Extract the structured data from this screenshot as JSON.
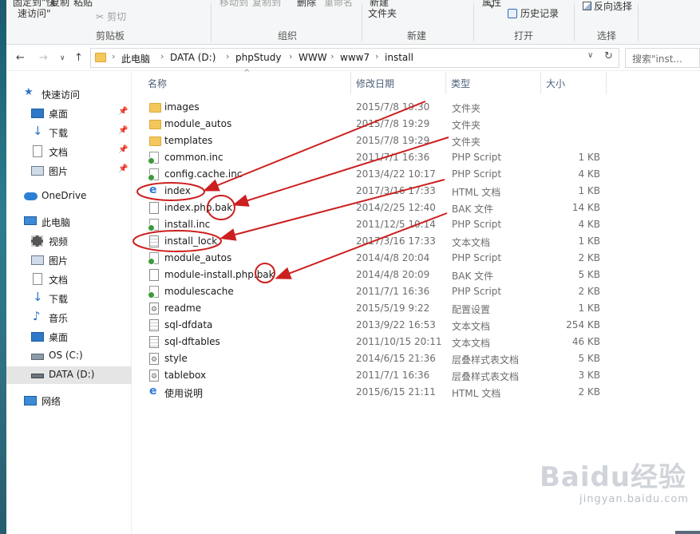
{
  "ribbon": {
    "clip_top": [
      {
        "label": "固定到\"快",
        "name": "pin-quick-access-button"
      },
      {
        "label": "复制",
        "name": "copy-button"
      },
      {
        "label": "粘贴",
        "name": "paste-button"
      },
      {
        "label": "移动到",
        "name": "move-to-button"
      },
      {
        "label": "复制到",
        "name": "copy-to-button"
      },
      {
        "label": "删除",
        "name": "delete-button"
      },
      {
        "label": "重命名",
        "name": "rename-button"
      },
      {
        "label": "新建",
        "name": "new-button"
      },
      {
        "label": "属性",
        "name": "properties-button"
      },
      {
        "label": "反向选择",
        "name": "invert-selection-button"
      }
    ],
    "pin_line2": "速访问\"",
    "cut": "剪切",
    "new_folder": "文件夹",
    "history": "历史记录",
    "groups": {
      "clipboard": "剪贴板",
      "organize": "组织",
      "new": "新建",
      "open": "打开",
      "select": "选择"
    }
  },
  "address": {
    "segments": [
      "此电脑",
      "DATA (D:)",
      "phpStudy",
      "WWW",
      "www7",
      "install"
    ],
    "search_placeholder": "搜索\"inst..."
  },
  "tree": {
    "quick_access": "快速访问",
    "qa_items": [
      "桌面",
      "下载",
      "文档",
      "图片"
    ],
    "onedrive": "OneDrive",
    "this_pc": "此电脑",
    "pc_items": [
      "视频",
      "图片",
      "文档",
      "下载",
      "音乐",
      "桌面",
      "OS (C:)",
      "DATA (D:)"
    ],
    "network": "网络"
  },
  "columns": {
    "name": "名称",
    "date": "修改日期",
    "type": "类型",
    "size": "大小"
  },
  "files": [
    {
      "name": "images",
      "date": "2015/7/8 19:30",
      "type": "文件夹",
      "size": "",
      "icon": "folder"
    },
    {
      "name": "module_autos",
      "date": "2015/7/8 19:29",
      "type": "文件夹",
      "size": "",
      "icon": "folder"
    },
    {
      "name": "templates",
      "date": "2015/7/8 19:29",
      "type": "文件夹",
      "size": "",
      "icon": "folder"
    },
    {
      "name": "common.inc",
      "date": "2011/7/1 16:36",
      "type": "PHP Script",
      "size": "1 KB",
      "icon": "php"
    },
    {
      "name": "config.cache.inc",
      "date": "2013/4/22 10:17",
      "type": "PHP Script",
      "size": "4 KB",
      "icon": "php"
    },
    {
      "name": "index",
      "date": "2017/3/16 17:33",
      "type": "HTML 文档",
      "size": "1 KB",
      "icon": "ie"
    },
    {
      "name": "index.php.bak",
      "date": "2014/2/25 12:40",
      "type": "BAK 文件",
      "size": "14 KB",
      "icon": "blank"
    },
    {
      "name": "install.inc",
      "date": "2011/12/5 10:14",
      "type": "PHP Script",
      "size": "4 KB",
      "icon": "php"
    },
    {
      "name": "install_lock",
      "date": "2017/3/16 17:33",
      "type": "文本文档",
      "size": "1 KB",
      "icon": "text"
    },
    {
      "name": "module_autos",
      "date": "2014/4/8 20:04",
      "type": "PHP Script",
      "size": "2 KB",
      "icon": "php"
    },
    {
      "name": "module-install.php.bak",
      "date": "2014/4/8 20:09",
      "type": "BAK 文件",
      "size": "5 KB",
      "icon": "blank"
    },
    {
      "name": "modulescache",
      "date": "2011/7/1 16:36",
      "type": "PHP Script",
      "size": "2 KB",
      "icon": "php"
    },
    {
      "name": "readme",
      "date": "2015/5/19 9:22",
      "type": "配置设置",
      "size": "1 KB",
      "icon": "config"
    },
    {
      "name": "sql-dfdata",
      "date": "2013/9/22 16:53",
      "type": "文本文档",
      "size": "254 KB",
      "icon": "text"
    },
    {
      "name": "sql-dftables",
      "date": "2011/10/15 20:11",
      "type": "文本文档",
      "size": "46 KB",
      "icon": "text"
    },
    {
      "name": "style",
      "date": "2014/6/15 21:36",
      "type": "层叠样式表文档",
      "size": "5 KB",
      "icon": "css"
    },
    {
      "name": "tablebox",
      "date": "2011/7/1 16:36",
      "type": "层叠样式表文档",
      "size": "3 KB",
      "icon": "css"
    },
    {
      "name": "使用说明",
      "date": "2015/6/15 21:11",
      "type": "HTML 文档",
      "size": "2 KB",
      "icon": "ie"
    }
  ],
  "watermark": {
    "brand": "Baidu经验",
    "url": "jingyan.baidu.com"
  },
  "colors": {
    "annotation": "#cc1f1f",
    "selection": "#e5e5e5",
    "folder": "#f3c75b"
  }
}
